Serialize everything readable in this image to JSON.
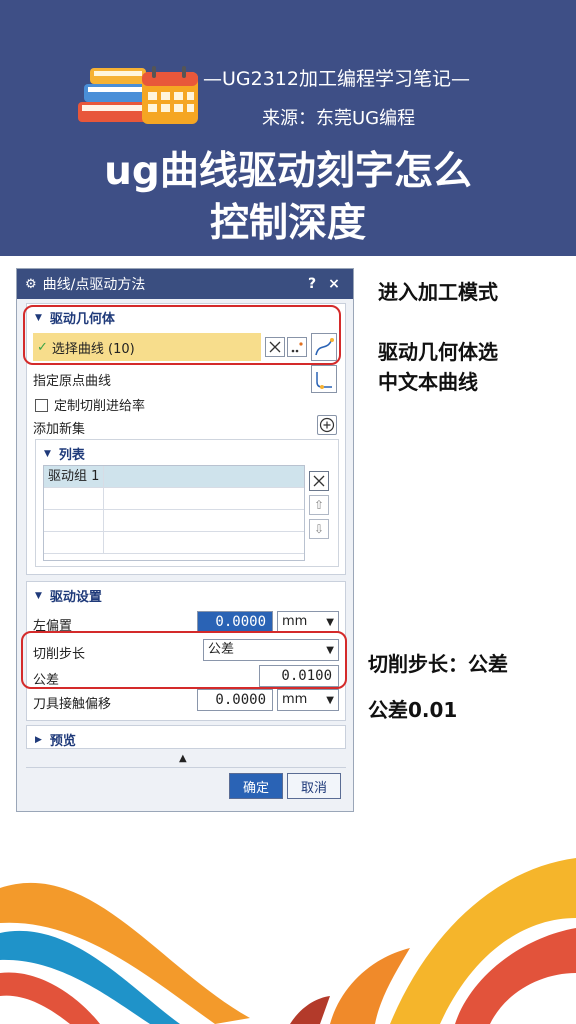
{
  "banner": {
    "subtitle": "—UG2312加工编程学习笔记—",
    "source": "来源：东莞UG编程",
    "title_line1": "ug曲线驱动刻字怎么",
    "title_line2": "控制深度"
  },
  "dialog": {
    "title": "曲线/点驱动方法",
    "help": "?",
    "close": "×",
    "drive_geometry": {
      "header": "驱动几何体",
      "select_curve": "选择曲线 (10)",
      "specify_origin_curve": "指定原点曲线",
      "custom_feedrate": "定制切削进给率",
      "add_new_set": "添加新集"
    },
    "list": {
      "header": "列表",
      "rows": [
        [
          "驱动组 1",
          ""
        ],
        [
          "",
          ""
        ],
        [
          "",
          ""
        ],
        [
          "",
          ""
        ]
      ]
    },
    "drive_settings": {
      "header": "驱动设置",
      "left_offset_label": "左偏置",
      "left_offset_value": "0.0000",
      "left_offset_unit": "mm",
      "step_label": "切削步长",
      "step_value": "公差",
      "tolerance_label": "公差",
      "tolerance_value": "0.0100",
      "contact_offset_label": "刀具接触偏移",
      "contact_offset_value": "0.0000",
      "contact_offset_unit": "mm"
    },
    "preview": {
      "header": "预览"
    },
    "ok": "确定",
    "cancel": "取消"
  },
  "notes": {
    "n1": "进入加工模式",
    "n2a": "驱动几何体选",
    "n2b": "中文本曲线",
    "n3": "切削步长：公差",
    "n4": "公差0.01"
  },
  "colors": {
    "banner": "#3e4f86",
    "dialog_title": "#3a4e80",
    "highlight": "#f7dd8c",
    "red_outline": "#d42a2a",
    "accent_blue": "#2a63b5"
  }
}
